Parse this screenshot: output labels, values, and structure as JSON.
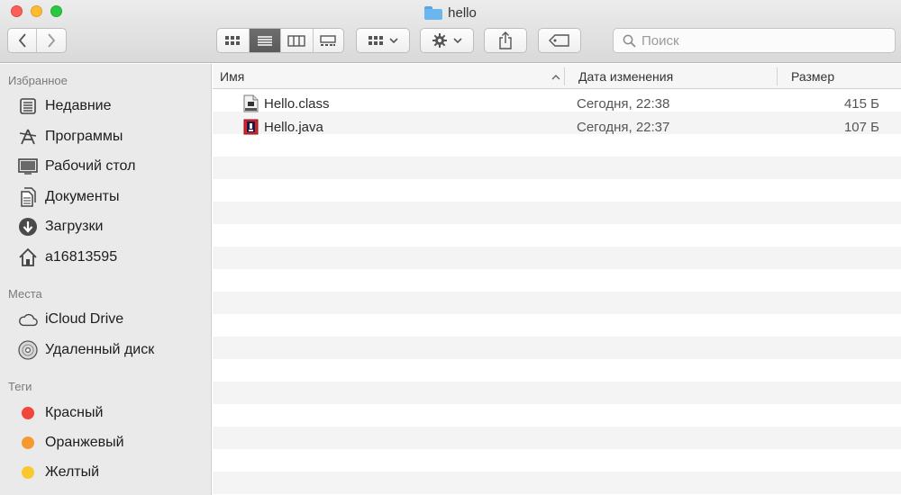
{
  "window": {
    "title": "hello",
    "title_icon": "folder-icon"
  },
  "toolbar": {
    "back_icon": "chevron-left-icon",
    "forward_icon": "chevron-right-icon",
    "view_modes": [
      "icon-view",
      "list-view",
      "column-view",
      "gallery-view"
    ],
    "active_view": "list-view",
    "arrange_icon": "group-grid-icon",
    "action_icon": "gear-icon",
    "share_icon": "share-icon",
    "tags_icon": "tag-icon",
    "search_placeholder": "Поиск"
  },
  "sidebar": {
    "favorites_label": "Избранное",
    "favorites": [
      {
        "label": "Недавние",
        "icon": "recents-icon"
      },
      {
        "label": "Программы",
        "icon": "applications-icon"
      },
      {
        "label": "Рабочий стол",
        "icon": "desktop-icon"
      },
      {
        "label": "Документы",
        "icon": "documents-icon"
      },
      {
        "label": "Загрузки",
        "icon": "downloads-icon"
      },
      {
        "label": "a16813595",
        "icon": "home-icon"
      }
    ],
    "places_label": "Места",
    "places": [
      {
        "label": "iCloud Drive",
        "icon": "cloud-icon"
      },
      {
        "label": "Удаленный диск",
        "icon": "remote-disc-icon"
      }
    ],
    "tags_label": "Теги",
    "tags": [
      {
        "label": "Красный",
        "color": "#f1463c"
      },
      {
        "label": "Оранжевый",
        "color": "#f69a30"
      },
      {
        "label": "Желтый",
        "color": "#f9c82d"
      }
    ]
  },
  "list": {
    "columns": {
      "name": "Имя",
      "date": "Дата изменения",
      "size": "Размер"
    },
    "sort_indicator": "chevron-up-icon",
    "files": [
      {
        "name": "Hello.class",
        "date": "Сегодня, 22:38",
        "size": "415 Б",
        "icon": "class-file-icon"
      },
      {
        "name": "Hello.java",
        "date": "Сегодня, 22:37",
        "size": "107 Б",
        "icon": "java-file-icon"
      }
    ]
  }
}
